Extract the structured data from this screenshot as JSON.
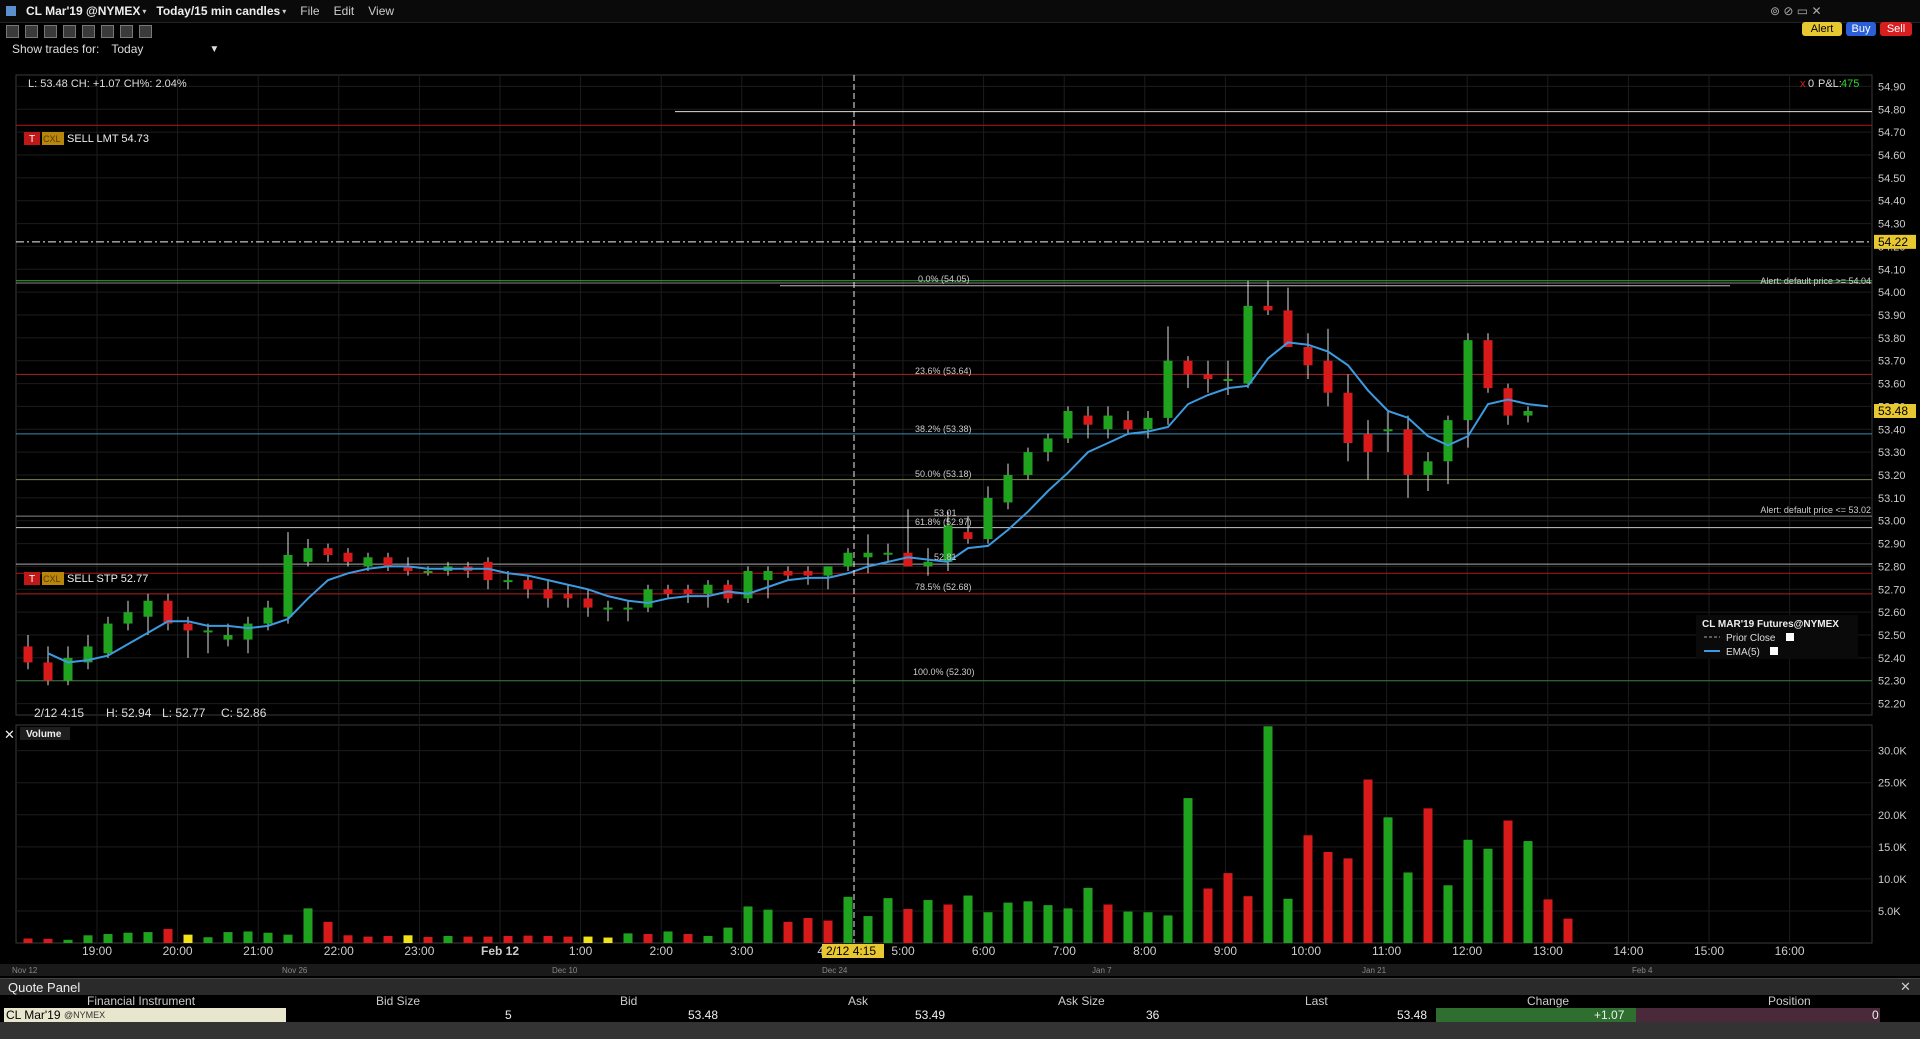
{
  "window": {
    "title": "CL Mar'19 @NYMEX",
    "period": "Today/15 min candles",
    "menus": [
      "File",
      "Edit",
      "View"
    ],
    "buttons": {
      "alert": "Alert",
      "buy": "Buy",
      "sell": "Sell"
    }
  },
  "show_trades": {
    "label": "Show trades for:",
    "value": "Today"
  },
  "header_info": "L: 53.48 CH: +1.07 CH%: 2.04%",
  "pnl": {
    "count": "0",
    "label": "P&L:",
    "value": "475"
  },
  "orders": {
    "sell_lmt": {
      "t": "T",
      "tag": "CXL",
      "label": "SELL LMT 54.73",
      "price": 54.73
    },
    "sell_stp": {
      "t": "T",
      "tag": "CXL",
      "label": "SELL STP 52.77",
      "price": 52.77
    }
  },
  "alerts": [
    {
      "label": "Alert: default price >= 54.04",
      "price": 54.04
    },
    {
      "label": "Alert: default price <= 53.02",
      "price": 53.02
    }
  ],
  "fib": [
    {
      "label": "0.0% (54.05)",
      "price": 54.05
    },
    {
      "label": "23.6% (53.64)",
      "price": 53.64
    },
    {
      "label": "38.2% (53.38)",
      "price": 53.38
    },
    {
      "label": "50.0% (53.18)",
      "price": 53.18
    },
    {
      "label": "61.8% (52.97)",
      "price": 52.97
    },
    {
      "label": "78.5% (52.68)",
      "price": 52.68
    },
    {
      "label": "100.0% (52.30)",
      "price": 52.3
    }
  ],
  "marks": {
    "m1": "53.01",
    "m2": "52.81"
  },
  "crosshair": {
    "time_label": "2/12 4:15",
    "price_label": "54.22",
    "price": 54.22
  },
  "last_price_label": "53.48",
  "ohlc_readout": {
    "date": "2/12 4:15",
    "h": "H: 52.94",
    "l": "L: 52.77",
    "c": "C: 52.86"
  },
  "legend": {
    "title": "CL MAR'19 Futures@NYMEX",
    "items": [
      "Prior Close",
      "EMA(5)"
    ]
  },
  "volume_label": "Volume",
  "nav_dates": [
    "Nov 12",
    "Nov 26",
    "Dec 10",
    "Dec 24",
    "Jan 7",
    "Jan 21",
    "Feb 4"
  ],
  "quote_panel": {
    "title": "Quote Panel",
    "columns": [
      "Financial Instrument",
      "Bid Size",
      "Bid",
      "Ask",
      "Ask Size",
      "Last",
      "Change",
      "Position"
    ],
    "row": {
      "instrument": "CL Mar'19",
      "exchange": "@NYMEX",
      "bid_size": "5",
      "bid": "53.48",
      "ask": "53.49",
      "ask_size": "36",
      "last": "53.48",
      "change": "+1.07",
      "position": "0"
    }
  },
  "colors": {
    "up": "#1fa31f",
    "down": "#d91a1a",
    "ema": "#3c9be0",
    "neutral_vol": "#f2e21a"
  },
  "chart_data": {
    "type": "candlestick",
    "price_axis": {
      "min": 52.15,
      "max": 54.95,
      "ticks": [
        52.2,
        52.3,
        52.4,
        52.5,
        52.6,
        52.7,
        52.8,
        52.9,
        53.0,
        53.1,
        53.2,
        53.3,
        53.4,
        53.5,
        53.6,
        53.7,
        53.8,
        53.9,
        54.0,
        54.1,
        54.2,
        54.3,
        54.4,
        54.5,
        54.6,
        54.7,
        54.8,
        54.9
      ]
    },
    "volume_axis": {
      "min": 0,
      "max": 34000,
      "ticks": [
        5000,
        10000,
        15000,
        20000,
        25000,
        30000
      ],
      "tick_labels": [
        "5.0K",
        "10.0K",
        "15.0K",
        "20.0K",
        "25.0K",
        "30.0K"
      ]
    },
    "time_labels": [
      "19:00",
      "20:00",
      "21:00",
      "22:00",
      "23:00",
      "Feb 12",
      "1:00",
      "2:00",
      "3:00",
      "4:",
      "5:00",
      "6:00",
      "7:00",
      "8:00",
      "9:00",
      "10:00",
      "11:00",
      "12:00",
      "13:00",
      "14:00",
      "15:00",
      "16:00"
    ],
    "candles": [
      {
        "o": 52.45,
        "h": 52.5,
        "l": 52.35,
        "c": 52.38
      },
      {
        "o": 52.38,
        "h": 52.45,
        "l": 52.28,
        "c": 52.3
      },
      {
        "o": 52.3,
        "h": 52.45,
        "l": 52.28,
        "c": 52.4
      },
      {
        "o": 52.38,
        "h": 52.5,
        "l": 52.35,
        "c": 52.45
      },
      {
        "o": 52.42,
        "h": 52.58,
        "l": 52.4,
        "c": 52.55
      },
      {
        "o": 52.55,
        "h": 52.65,
        "l": 52.52,
        "c": 52.6
      },
      {
        "o": 52.58,
        "h": 52.68,
        "l": 52.5,
        "c": 52.65
      },
      {
        "o": 52.65,
        "h": 52.68,
        "l": 52.52,
        "c": 52.55
      },
      {
        "o": 52.55,
        "h": 52.58,
        "l": 52.4,
        "c": 52.52
      },
      {
        "o": 52.52,
        "h": 52.55,
        "l": 52.42,
        "c": 52.52
      },
      {
        "o": 52.48,
        "h": 52.55,
        "l": 52.45,
        "c": 52.5
      },
      {
        "o": 52.48,
        "h": 52.58,
        "l": 52.42,
        "c": 52.55
      },
      {
        "o": 52.55,
        "h": 52.65,
        "l": 52.52,
        "c": 52.62
      },
      {
        "o": 52.58,
        "h": 52.95,
        "l": 52.55,
        "c": 52.85
      },
      {
        "o": 52.82,
        "h": 52.92,
        "l": 52.8,
        "c": 52.88
      },
      {
        "o": 52.88,
        "h": 52.9,
        "l": 52.82,
        "c": 52.85
      },
      {
        "o": 52.86,
        "h": 52.88,
        "l": 52.8,
        "c": 52.82
      },
      {
        "o": 52.8,
        "h": 52.86,
        "l": 52.78,
        "c": 52.84
      },
      {
        "o": 52.84,
        "h": 52.86,
        "l": 52.78,
        "c": 52.8
      },
      {
        "o": 52.8,
        "h": 52.84,
        "l": 52.76,
        "c": 52.78
      },
      {
        "o": 52.78,
        "h": 52.8,
        "l": 52.76,
        "c": 52.78
      },
      {
        "o": 52.78,
        "h": 52.82,
        "l": 52.76,
        "c": 52.8
      },
      {
        "o": 52.8,
        "h": 52.82,
        "l": 52.75,
        "c": 52.78
      },
      {
        "o": 52.82,
        "h": 52.84,
        "l": 52.7,
        "c": 52.74
      },
      {
        "o": 52.74,
        "h": 52.78,
        "l": 52.7,
        "c": 52.74
      },
      {
        "o": 52.74,
        "h": 52.76,
        "l": 52.66,
        "c": 52.7
      },
      {
        "o": 52.7,
        "h": 52.74,
        "l": 52.62,
        "c": 52.66
      },
      {
        "o": 52.68,
        "h": 52.72,
        "l": 52.62,
        "c": 52.66
      },
      {
        "o": 52.66,
        "h": 52.7,
        "l": 52.58,
        "c": 52.62
      },
      {
        "o": 52.62,
        "h": 52.65,
        "l": 52.56,
        "c": 52.62
      },
      {
        "o": 52.62,
        "h": 52.65,
        "l": 52.56,
        "c": 52.62
      },
      {
        "o": 52.62,
        "h": 52.72,
        "l": 52.6,
        "c": 52.7
      },
      {
        "o": 52.7,
        "h": 52.72,
        "l": 52.66,
        "c": 52.68
      },
      {
        "o": 52.7,
        "h": 52.72,
        "l": 52.64,
        "c": 52.68
      },
      {
        "o": 52.68,
        "h": 52.74,
        "l": 52.62,
        "c": 52.72
      },
      {
        "o": 52.72,
        "h": 52.74,
        "l": 52.64,
        "c": 52.66
      },
      {
        "o": 52.66,
        "h": 52.8,
        "l": 52.64,
        "c": 52.78
      },
      {
        "o": 52.74,
        "h": 52.8,
        "l": 52.66,
        "c": 52.78
      },
      {
        "o": 52.78,
        "h": 52.8,
        "l": 52.74,
        "c": 52.76
      },
      {
        "o": 52.78,
        "h": 52.8,
        "l": 52.72,
        "c": 52.76
      },
      {
        "o": 52.76,
        "h": 52.8,
        "l": 52.7,
        "c": 52.8
      },
      {
        "o": 52.8,
        "h": 52.88,
        "l": 52.78,
        "c": 52.86
      },
      {
        "o": 52.84,
        "h": 52.94,
        "l": 52.77,
        "c": 52.86
      },
      {
        "o": 52.86,
        "h": 52.9,
        "l": 52.82,
        "c": 52.86
      },
      {
        "o": 52.86,
        "h": 53.05,
        "l": 52.8,
        "c": 52.8
      },
      {
        "o": 52.8,
        "h": 52.88,
        "l": 52.76,
        "c": 52.82
      },
      {
        "o": 52.82,
        "h": 53.04,
        "l": 52.78,
        "c": 52.98
      },
      {
        "o": 52.95,
        "h": 53.02,
        "l": 52.9,
        "c": 52.92
      },
      {
        "o": 52.92,
        "h": 53.15,
        "l": 52.9,
        "c": 53.1
      },
      {
        "o": 53.08,
        "h": 53.25,
        "l": 53.05,
        "c": 53.2
      },
      {
        "o": 53.2,
        "h": 53.32,
        "l": 53.18,
        "c": 53.3
      },
      {
        "o": 53.3,
        "h": 53.38,
        "l": 53.26,
        "c": 53.36
      },
      {
        "o": 53.36,
        "h": 53.5,
        "l": 53.34,
        "c": 53.48
      },
      {
        "o": 53.46,
        "h": 53.5,
        "l": 53.36,
        "c": 53.42
      },
      {
        "o": 53.4,
        "h": 53.5,
        "l": 53.36,
        "c": 53.46
      },
      {
        "o": 53.44,
        "h": 53.48,
        "l": 53.38,
        "c": 53.4
      },
      {
        "o": 53.4,
        "h": 53.48,
        "l": 53.36,
        "c": 53.45
      },
      {
        "o": 53.45,
        "h": 53.85,
        "l": 53.42,
        "c": 53.7
      },
      {
        "o": 53.7,
        "h": 53.72,
        "l": 53.58,
        "c": 53.64
      },
      {
        "o": 53.64,
        "h": 53.7,
        "l": 53.56,
        "c": 53.62
      },
      {
        "o": 53.62,
        "h": 53.7,
        "l": 53.55,
        "c": 53.62
      },
      {
        "o": 53.6,
        "h": 54.05,
        "l": 53.58,
        "c": 53.94
      },
      {
        "o": 53.94,
        "h": 54.05,
        "l": 53.9,
        "c": 53.92
      },
      {
        "o": 53.92,
        "h": 54.02,
        "l": 53.8,
        "c": 53.76
      },
      {
        "o": 53.76,
        "h": 53.82,
        "l": 53.62,
        "c": 53.68
      },
      {
        "o": 53.7,
        "h": 53.84,
        "l": 53.5,
        "c": 53.56
      },
      {
        "o": 53.56,
        "h": 53.64,
        "l": 53.26,
        "c": 53.34
      },
      {
        "o": 53.38,
        "h": 53.44,
        "l": 53.18,
        "c": 53.3
      },
      {
        "o": 53.4,
        "h": 53.48,
        "l": 53.3,
        "c": 53.4
      },
      {
        "o": 53.4,
        "h": 53.46,
        "l": 53.1,
        "c": 53.2
      },
      {
        "o": 53.2,
        "h": 53.3,
        "l": 53.13,
        "c": 53.26
      },
      {
        "o": 53.26,
        "h": 53.46,
        "l": 53.16,
        "c": 53.44
      },
      {
        "o": 53.44,
        "h": 53.82,
        "l": 53.32,
        "c": 53.79
      },
      {
        "o": 53.79,
        "h": 53.82,
        "l": 53.56,
        "c": 53.58
      },
      {
        "o": 53.58,
        "h": 53.6,
        "l": 53.42,
        "c": 53.46
      },
      {
        "o": 53.46,
        "h": 53.5,
        "l": 53.43,
        "c": 53.48
      }
    ],
    "ema": [
      52.42,
      52.38,
      52.39,
      52.41,
      52.46,
      52.51,
      52.56,
      52.56,
      52.54,
      52.54,
      52.53,
      52.54,
      52.57,
      52.66,
      52.74,
      52.77,
      52.79,
      52.8,
      52.8,
      52.79,
      52.79,
      52.79,
      52.79,
      52.77,
      52.76,
      52.74,
      52.72,
      52.7,
      52.67,
      52.65,
      52.64,
      52.66,
      52.67,
      52.67,
      52.69,
      52.68,
      52.71,
      52.74,
      52.75,
      52.75,
      52.77,
      52.8,
      52.82,
      52.84,
      52.83,
      52.82,
      52.88,
      52.89,
      52.96,
      53.04,
      53.13,
      53.21,
      53.3,
      53.34,
      53.38,
      53.39,
      53.41,
      53.51,
      53.55,
      53.58,
      53.59,
      53.71,
      53.78,
      53.77,
      53.74,
      53.68,
      53.57,
      53.48,
      53.45,
      53.37,
      53.33,
      53.37,
      53.51,
      53.53,
      53.51,
      53.5
    ],
    "volume": [
      700,
      650,
      500,
      1200,
      1400,
      1600,
      1700,
      2200,
      1300,
      900,
      1700,
      1800,
      1600,
      1300,
      5400,
      3300,
      1200,
      1000,
      1100,
      1200,
      950,
      1100,
      1000,
      1000,
      1100,
      1150,
      1100,
      1000,
      1000,
      850,
      1500,
      1400,
      1800,
      1400,
      1100,
      2400,
      5700,
      5200,
      3300,
      3900,
      3500,
      7200,
      4200,
      7000,
      5300,
      6700,
      6000,
      7400,
      4800,
      6300,
      6500,
      5900,
      5400,
      8600,
      6000,
      4900,
      4800,
      4300,
      22600,
      8500,
      10900,
      7300,
      33800,
      6900,
      16800,
      14200,
      13200,
      25500,
      19600,
      11000,
      21000,
      9000,
      16100,
      14700,
      19100,
      15900,
      6800,
      3800
    ],
    "volume_colors": [
      "r",
      "r",
      "g",
      "g",
      "g",
      "g",
      "g",
      "r",
      "y",
      "g",
      "g",
      "g",
      "g",
      "g",
      "g",
      "r",
      "r",
      "r",
      "r",
      "y",
      "r",
      "g",
      "r",
      "r",
      "r",
      "r",
      "r",
      "r",
      "y",
      "y",
      "g",
      "r",
      "g",
      "r",
      "g",
      "g",
      "g",
      "g",
      "r",
      "r",
      "r",
      "g",
      "g",
      "g",
      "r",
      "g",
      "r",
      "g",
      "g",
      "g",
      "g",
      "g",
      "g",
      "g",
      "r",
      "g",
      "g",
      "g",
      "g",
      "r",
      "r",
      "r",
      "g",
      "g",
      "r",
      "r",
      "r",
      "r",
      "g",
      "g",
      "r",
      "g",
      "g",
      "g",
      "r",
      "g"
    ]
  }
}
